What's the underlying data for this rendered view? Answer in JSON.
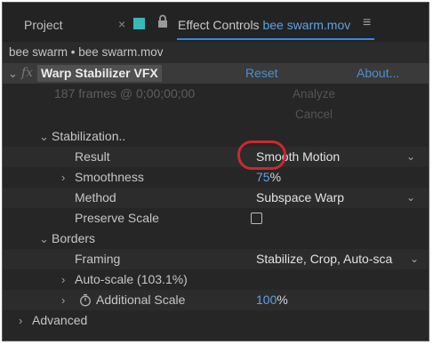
{
  "tabs": {
    "project_label": "Project",
    "close_glyph": "×",
    "lock_icon": "lock-icon",
    "active_prefix": "Effect Controls",
    "active_clip": "bee swarm.mov",
    "menu_glyph": "≡",
    "swatch_color": "#36b9b7",
    "active_underline_color": "#2d8ceb"
  },
  "breadcrumb": "bee swarm • bee swarm.mov",
  "effect": {
    "fx_glyph": "fx",
    "name": "Warp Stabilizer VFX",
    "reset_label": "Reset",
    "about_label": "About...",
    "status": "187 frames @ 0;00;00;00",
    "analyze_label": "Analyze",
    "cancel_label": "Cancel"
  },
  "stabilization": {
    "section_label": "Stabilization..",
    "result_label": "Result",
    "result_value": "Smooth Motion",
    "smoothness_label": "Smoothness",
    "smoothness_value": "75",
    "smoothness_unit": "%",
    "method_label": "Method",
    "method_value": "Subspace Warp",
    "preserve_scale_label": "Preserve Scale",
    "preserve_scale_checked": false
  },
  "borders": {
    "section_label": "Borders",
    "framing_label": "Framing",
    "framing_value": "Stabilize, Crop, Auto-sca",
    "auto_scale_label": "Auto-scale (103.1%)",
    "additional_scale_label": "Additional Scale",
    "additional_scale_value": "100",
    "additional_scale_unit": "%"
  },
  "advanced_label": "Advanced",
  "colors": {
    "link_blue": "#4c8fcf",
    "value_blue": "#5aa3e6",
    "highlight_red": "#c82a2f"
  }
}
